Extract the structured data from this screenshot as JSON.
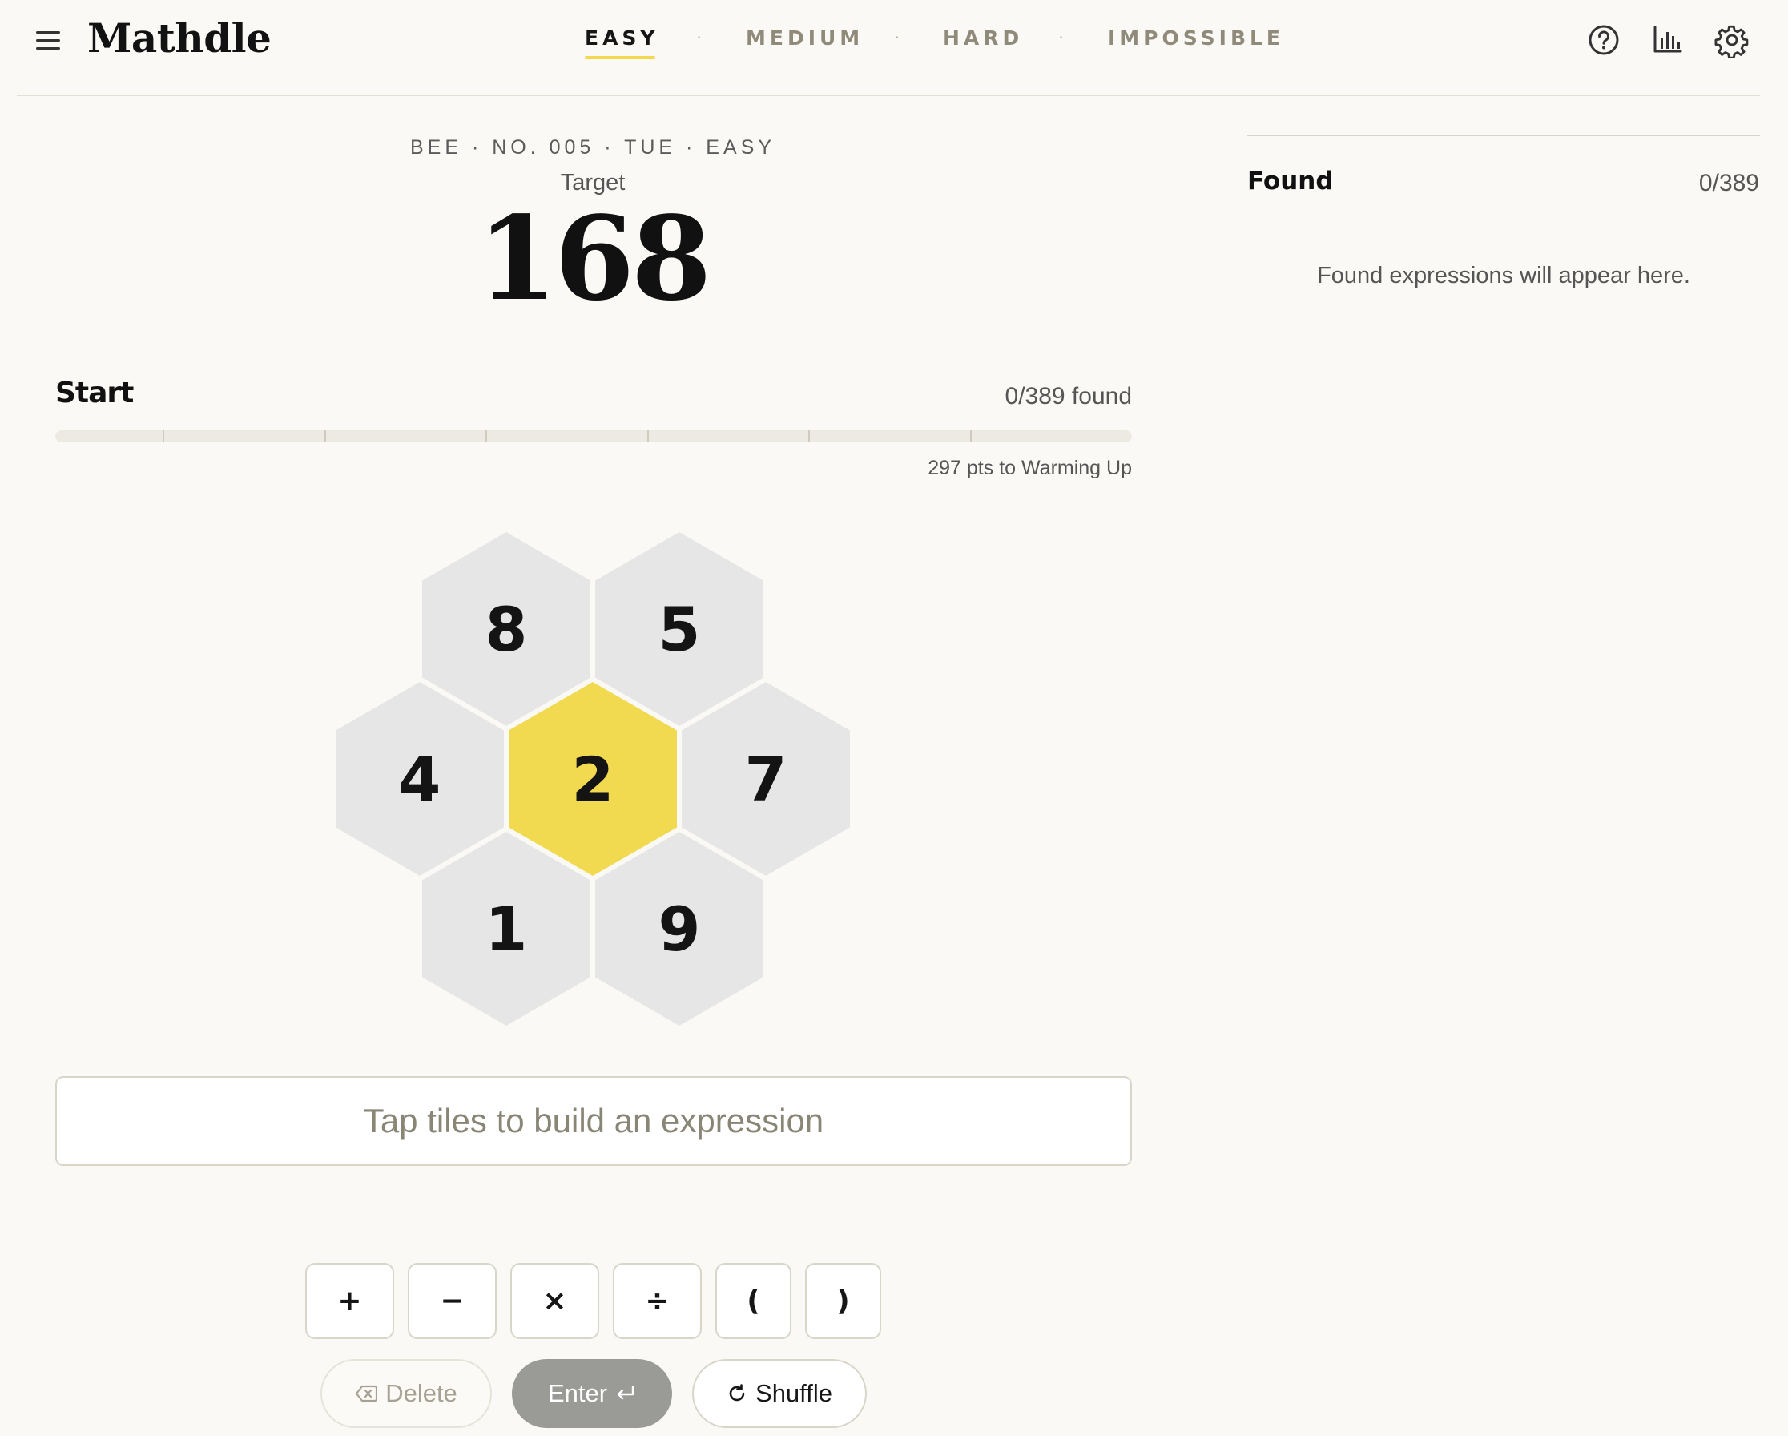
{
  "header": {
    "logo": "Mathdle",
    "tabs": [
      {
        "label": "EASY",
        "active": true
      },
      {
        "label": "MEDIUM",
        "active": false
      },
      {
        "label": "HARD",
        "active": false
      },
      {
        "label": "IMPOSSIBLE",
        "active": false
      }
    ],
    "separator": "·",
    "icons": [
      "menu-icon",
      "help-icon",
      "stats-icon",
      "settings-icon"
    ]
  },
  "puzzle": {
    "subtitle": "BEE · NO. 005 · TUE · EASY",
    "target_label": "Target",
    "target_value": "168"
  },
  "progress": {
    "rank": "Start",
    "found": "0/389 found",
    "fraction": 0,
    "next_rank": "297 pts to Warming Up"
  },
  "hive": {
    "tiles": [
      {
        "value": "8",
        "center": false
      },
      {
        "value": "5",
        "center": false
      },
      {
        "value": "4",
        "center": false
      },
      {
        "value": "2",
        "center": true
      },
      {
        "value": "7",
        "center": false
      },
      {
        "value": "1",
        "center": false
      },
      {
        "value": "9",
        "center": false
      }
    ]
  },
  "expression": {
    "placeholder": "Tap tiles to build an expression"
  },
  "operators": [
    "+",
    "−",
    "×",
    "÷",
    "(",
    ")"
  ],
  "actions": {
    "delete": "Delete",
    "enter": "Enter",
    "shuffle": "Shuffle"
  },
  "found_panel": {
    "title": "Found",
    "count": "0/389",
    "empty_message": "Found expressions will appear here."
  },
  "colors": {
    "background": "#faf9f5",
    "accent": "#f3d850",
    "tile": "#e6e6e6",
    "center_tile": "#f1da50"
  }
}
